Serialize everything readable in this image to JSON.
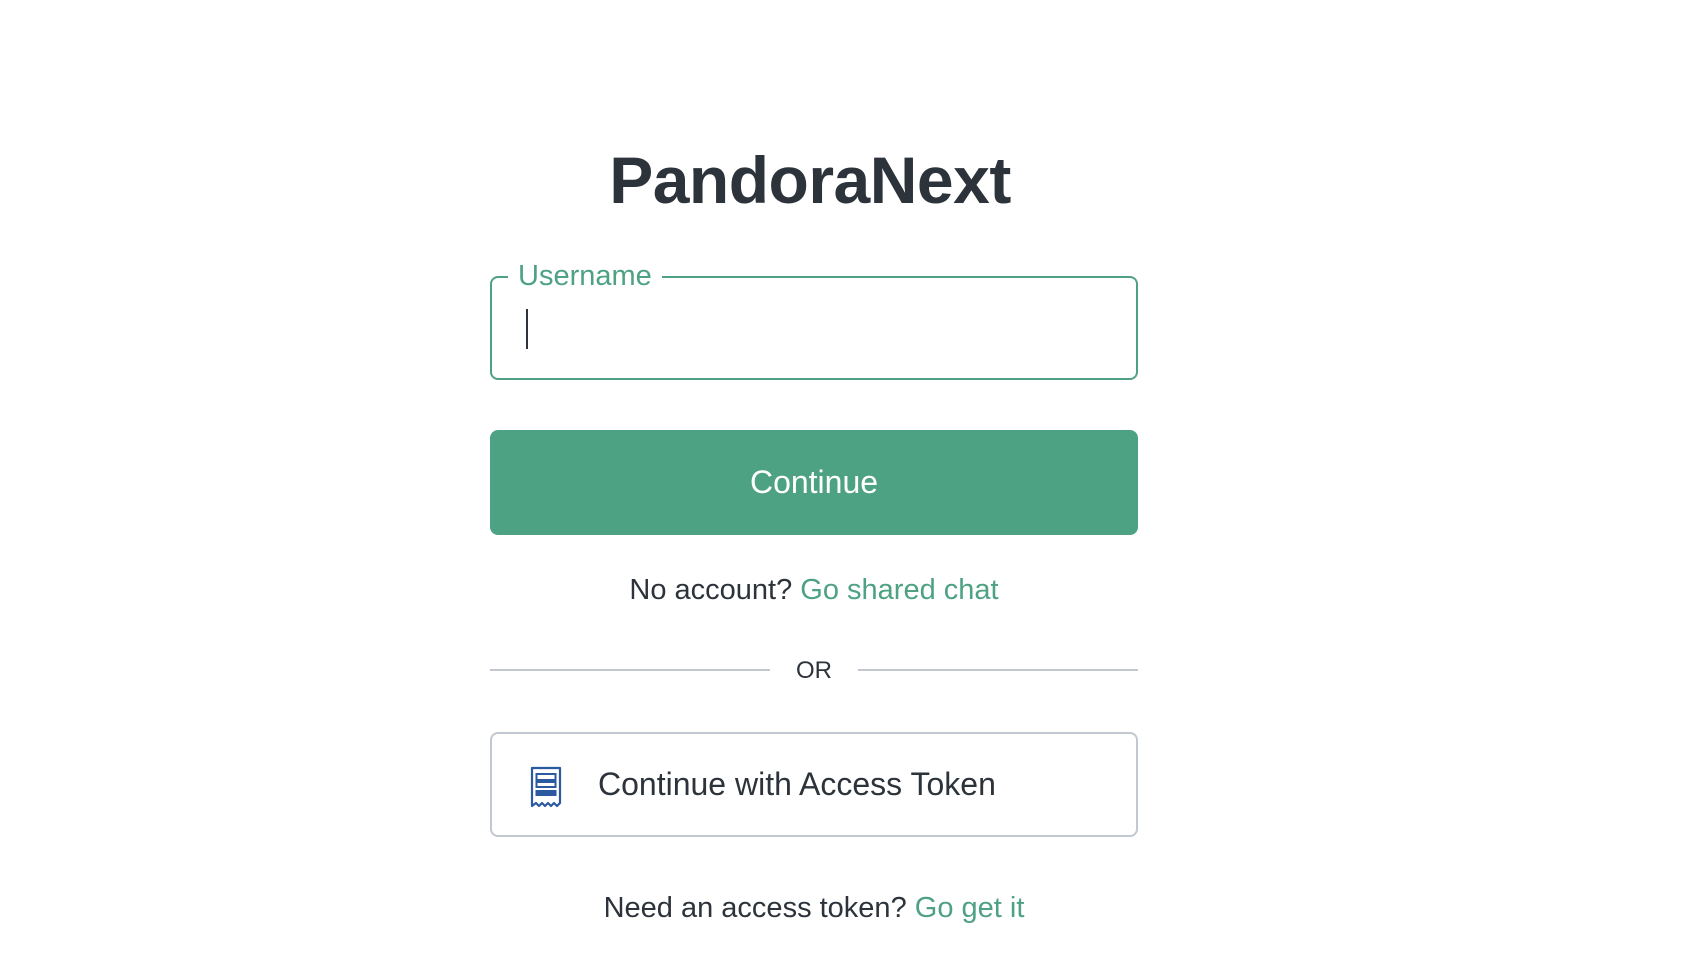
{
  "app": {
    "title": "PandoraNext"
  },
  "login": {
    "username_label": "Username",
    "username_value": "",
    "continue_label": "Continue",
    "no_account_text": "No account?",
    "shared_chat_link": "Go shared chat",
    "divider_text": "OR",
    "token_button_label": "Continue with Access Token",
    "token_button_icon": "receipt-icon",
    "need_token_text": "Need an access token?",
    "get_token_link": "Go get it"
  },
  "colors": {
    "accent": "#4da283",
    "text": "#2d333a",
    "border": "#c2c8d0",
    "icon": "#2b5aa0"
  }
}
